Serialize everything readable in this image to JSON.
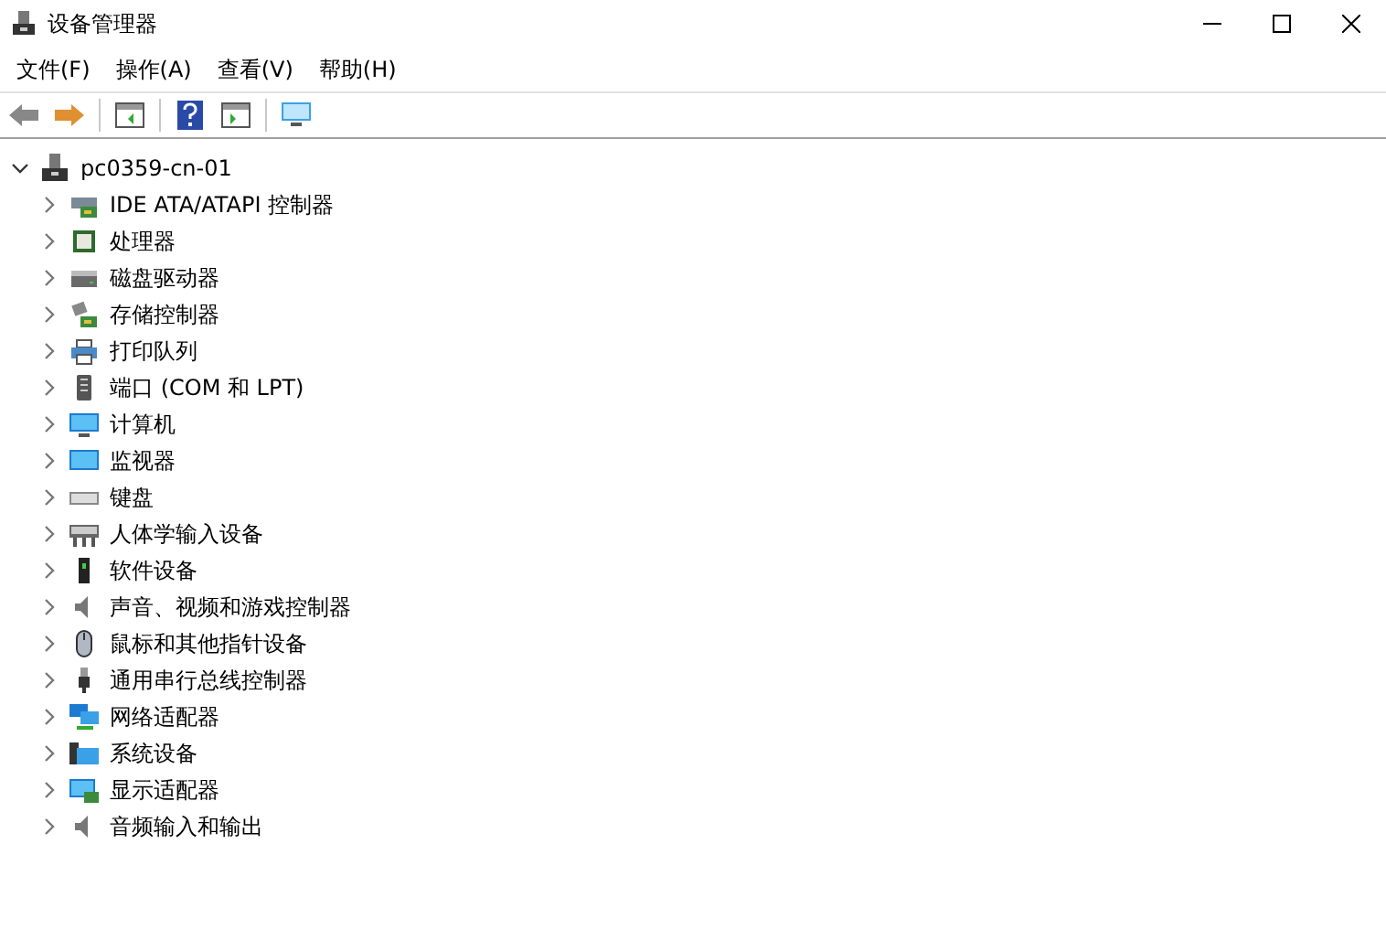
{
  "window": {
    "title": "设备管理器"
  },
  "menu": [
    "文件(F)",
    "操作(A)",
    "查看(V)",
    "帮助(H)"
  ],
  "tree": {
    "label": "pc0359-cn-01",
    "expanded": true,
    "children": [
      {
        "label": "IDE ATA/ATAPI 控制器",
        "expanded": false
      },
      {
        "label": "处理器",
        "expanded": false
      },
      {
        "label": "磁盘驱动器",
        "expanded": false
      },
      {
        "label": "存储控制器",
        "expanded": false
      },
      {
        "label": "打印队列",
        "expanded": false
      },
      {
        "label": "端口 (COM 和 LPT)",
        "expanded": false
      },
      {
        "label": "计算机",
        "expanded": false
      },
      {
        "label": "监视器",
        "expanded": false
      },
      {
        "label": "键盘",
        "expanded": false
      },
      {
        "label": "人体学输入设备",
        "expanded": false
      },
      {
        "label": "软件设备",
        "expanded": false
      },
      {
        "label": "声音、视频和游戏控制器",
        "expanded": false
      },
      {
        "label": "鼠标和其他指针设备",
        "expanded": false
      },
      {
        "label": "通用串行总线控制器",
        "expanded": false
      },
      {
        "label": "网络适配器",
        "expanded": false
      },
      {
        "label": "系统设备",
        "expanded": false
      },
      {
        "label": "显示适配器",
        "expanded": false
      },
      {
        "label": "音频输入和输出",
        "expanded": false
      }
    ]
  }
}
